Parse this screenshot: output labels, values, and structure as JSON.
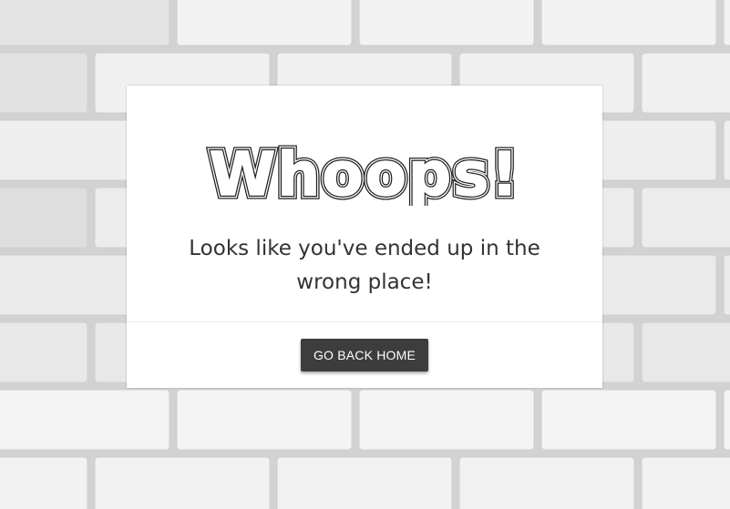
{
  "page": {
    "background": "white-brick-wall",
    "accent_color": "#3d3d3d"
  },
  "card": {
    "headline": "Whoops!",
    "message": "Looks like you've ended up in the wrong place!",
    "button_label": "GO BACK HOME"
  }
}
